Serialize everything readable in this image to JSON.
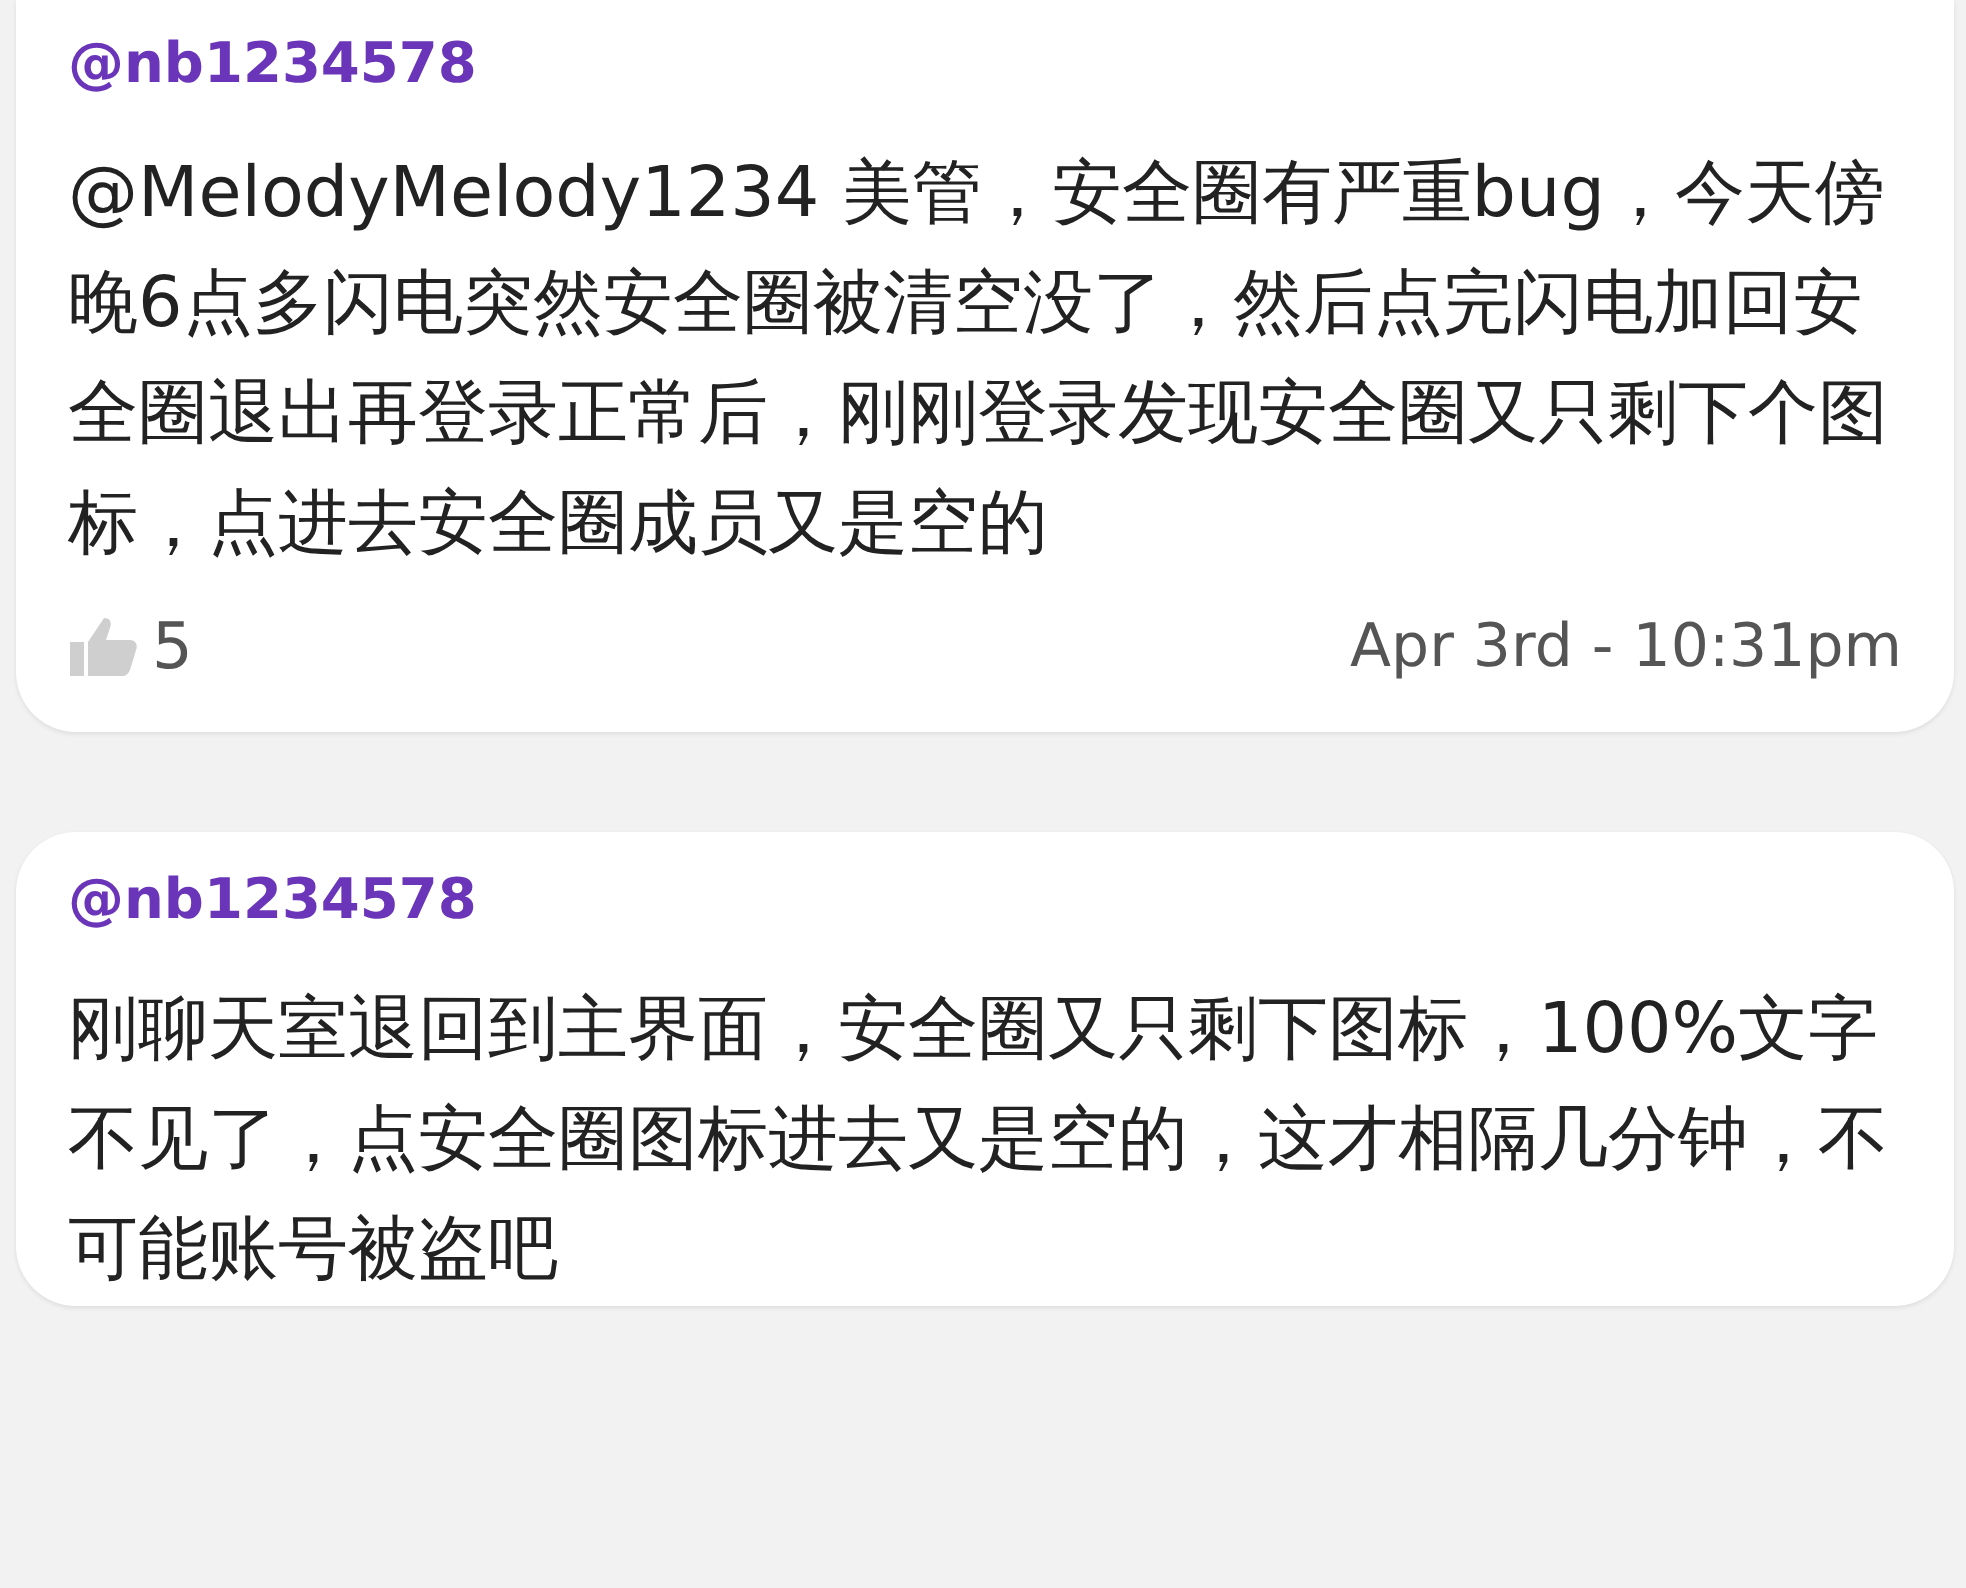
{
  "comments": [
    {
      "username": "@nb1234578",
      "text": "@MelodyMelody1234 美管，安全圈有严重bug，今天傍晚6点多闪电突然安全圈被清空没了，然后点完闪电加回安全圈退出再登录正常后，刚刚登录发现安全圈又只剩下个图标，点进去安全圈成员又是空的",
      "likes": "5",
      "time": "Apr 3rd - 10:31pm"
    },
    {
      "username": "@nb1234578",
      "text": "刚聊天室退回到主界面，安全圈又只剩下图标，100%文字不见了，点安全圈图标进去又是空的，这才相隔几分钟，不可能账号被盗吧"
    }
  ]
}
